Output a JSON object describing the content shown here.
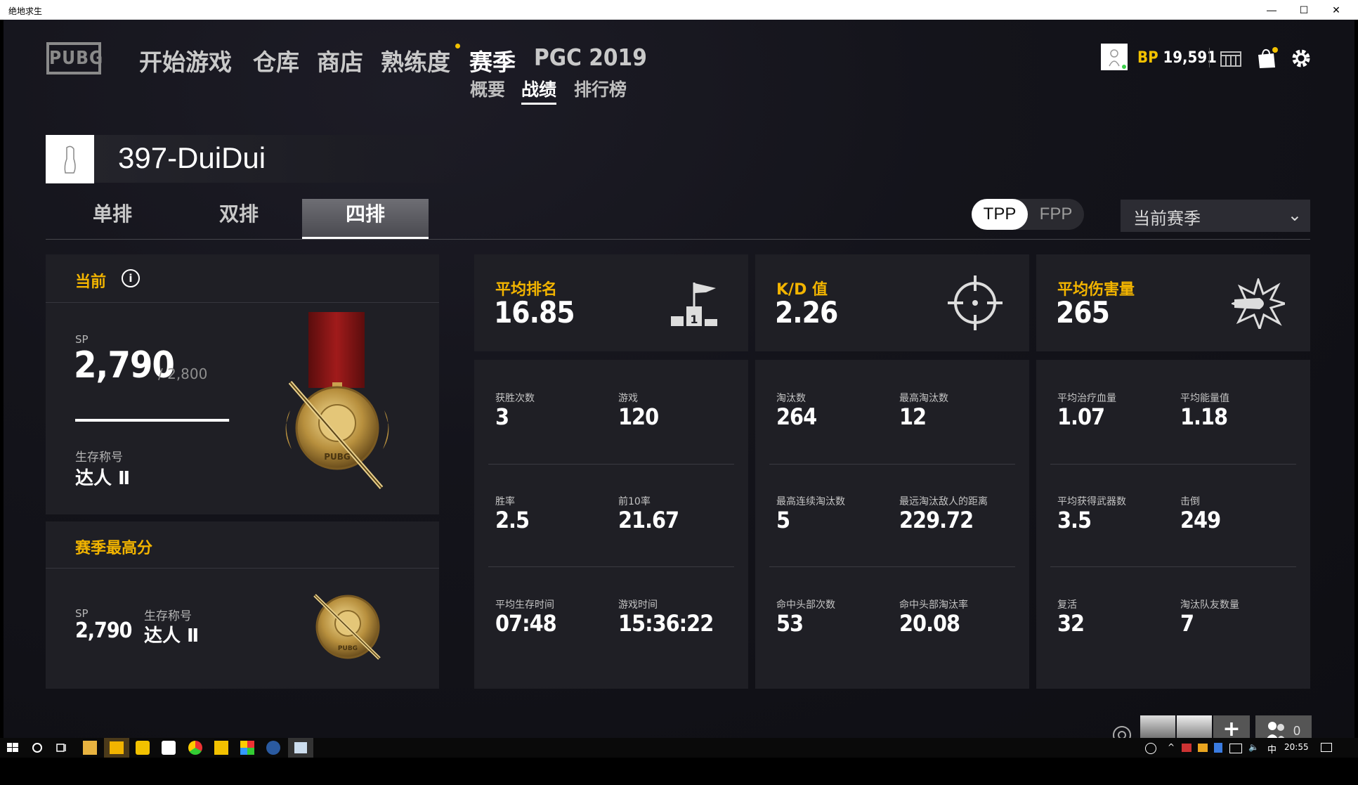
{
  "window": {
    "title": "绝地求生",
    "minimize": "—",
    "maximize": "☐",
    "close": "✕"
  },
  "nav": {
    "logo": "PUBG",
    "items": [
      "开始游戏",
      "仓库",
      "商店",
      "熟练度",
      "赛季",
      "PGC 2019"
    ],
    "active": "赛季",
    "subitems": [
      "概要",
      "战绩",
      "排行榜"
    ],
    "active_sub": "战绩"
  },
  "top_right": {
    "bp_label": "BP",
    "bp_value": "19,591"
  },
  "profile": {
    "name": "397-DuiDui"
  },
  "modes": {
    "tabs": [
      "单排",
      "双排",
      "四排"
    ],
    "active": "四排"
  },
  "perspective": {
    "options": [
      "TPP",
      "FPP"
    ],
    "active": "TPP"
  },
  "season_select": {
    "value": "当前赛季"
  },
  "current": {
    "title": "当前",
    "sp_label": "SP",
    "sp_value": "2,790",
    "sp_max": "/ 2,800",
    "sp_progress": 0.9964,
    "title_label": "生存称号",
    "title_value": "达人 Ⅱ"
  },
  "season_best": {
    "title": "赛季最高分",
    "sp_label": "SP",
    "sp_value": "2,790",
    "title_label": "生存称号",
    "title_value": "达人 Ⅱ"
  },
  "highlights": [
    {
      "label": "平均排名",
      "value": "16.85",
      "icon": "podium-flag-icon"
    },
    {
      "label": "K/D 值",
      "value": "2.26",
      "icon": "crosshair-icon"
    },
    {
      "label": "平均伤害量",
      "value": "265",
      "icon": "bullet-impact-icon"
    }
  ],
  "stats": {
    "col1": [
      {
        "l1": "获胜次数",
        "v1": "3",
        "l2": "游戏",
        "v2": "120"
      },
      {
        "l1": "胜率",
        "v1": "2.5",
        "l2": "前10率",
        "v2": "21.67"
      },
      {
        "l1": "平均生存时间",
        "v1": "07:48",
        "l2": "游戏时间",
        "v2": "15:36:22"
      }
    ],
    "col2": [
      {
        "l1": "淘汰数",
        "v1": "264",
        "l2": "最高淘汰数",
        "v2": "12"
      },
      {
        "l1": "最高连续淘汰数",
        "v1": "5",
        "l2": "最远淘汰敌人的距离",
        "v2": "229.72"
      },
      {
        "l1": "命中头部次数",
        "v1": "53",
        "l2": "命中头部淘汰率",
        "v2": "20.08"
      }
    ],
    "col3": [
      {
        "l1": "平均治疗血量",
        "v1": "1.07",
        "l2": "平均能量值",
        "v2": "1.18"
      },
      {
        "l1": "平均获得武器数",
        "v1": "3.5",
        "l2": "击倒",
        "v2": "249"
      },
      {
        "l1": "复活",
        "v1": "32",
        "l2": "淘汰队友数量",
        "v2": "7"
      }
    ]
  },
  "party": {
    "count": "0"
  },
  "taskbar": {
    "time": "20:55",
    "ime": "中"
  },
  "colors": {
    "accent_gold": "#f2b400",
    "panel": "#1f1f25",
    "bg": "#14141b"
  }
}
